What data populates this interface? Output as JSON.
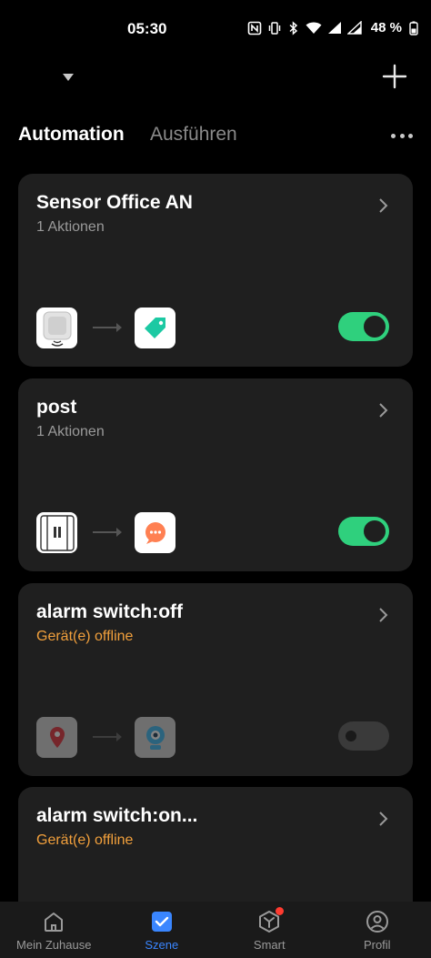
{
  "status_bar": {
    "time": "05:30",
    "battery": "48 %"
  },
  "tabs": {
    "active": "Automation",
    "inactive": "Ausführen"
  },
  "cards": [
    {
      "title": "Sensor Office AN",
      "subtitle": "1 Aktionen",
      "offline": false,
      "enabled": true,
      "trigger_icon": "motion-sensor-icon",
      "action_icon": "tag-icon"
    },
    {
      "title": "post",
      "subtitle": "1 Aktionen",
      "offline": false,
      "enabled": true,
      "trigger_icon": "door-sensor-icon",
      "action_icon": "message-icon"
    },
    {
      "title": "alarm switch:off",
      "subtitle": "Gerät(e) offline",
      "offline": true,
      "enabled": false,
      "trigger_icon": "location-pin-icon",
      "action_icon": "camera-icon"
    },
    {
      "title": "alarm switch:on...",
      "subtitle": "Gerät(e) offline",
      "offline": true
    }
  ],
  "nav": {
    "items": [
      {
        "label": "Mein Zuhause",
        "icon": "home-icon"
      },
      {
        "label": "Szene",
        "icon": "scene-icon",
        "active": true
      },
      {
        "label": "Smart",
        "icon": "smart-icon",
        "badge": true
      },
      {
        "label": "Profil",
        "icon": "profile-icon"
      }
    ]
  },
  "colors": {
    "background": "#000000",
    "card": "#1f1f1f",
    "toggle_on": "#2fd07d",
    "offline_text": "#f2a03c",
    "accent": "#3a86ff"
  }
}
